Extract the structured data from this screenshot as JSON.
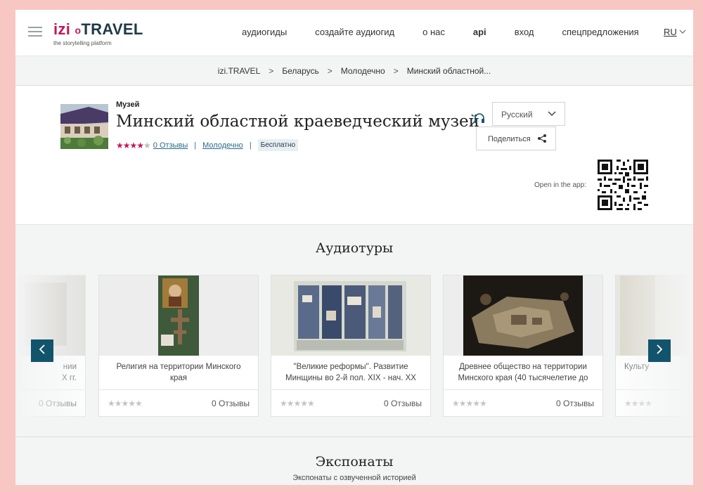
{
  "header": {
    "logo": {
      "izi": "izi",
      "dot": "o",
      "travel": "TRAVEL",
      "tagline": "the storytelling platform"
    },
    "nav": [
      "аудиогиды",
      "создайте аудиогид",
      "о нас",
      "api",
      "вход",
      "спецпредложения"
    ],
    "language": "RU"
  },
  "breadcrumb": [
    "izi.TRAVEL",
    "Беларусь",
    "Молодечно",
    "Минский областной..."
  ],
  "museum": {
    "category": "Музей",
    "title": "Минский областной краеведческий музей",
    "rating_stars": "★★★★",
    "rating_empty": "★",
    "rating_value": 4,
    "reviews": "0 Отзывы",
    "city": "Молодечно",
    "price": "Бесплатно",
    "language_select": "Русский",
    "share": "Поделиться",
    "open_in_app": "Open in the app:"
  },
  "audiotours": {
    "title": "Аудиотуры",
    "cards": [
      {
        "title": "Религия на территории Минского края",
        "stars": "★★★★★",
        "reviews": "0 Отзывы"
      },
      {
        "title": "\"Великие реформы\". Развитие Минщины во 2-й пол. XIX - нач. XX",
        "stars": "★★★★★",
        "reviews": "0 Отзывы"
      },
      {
        "title": "Древнее общество на территории Минского края (40 тысячелетие до",
        "stars": "★★★★★",
        "reviews": "0 Отзывы"
      }
    ],
    "left_partial": {
      "title_line1": "нии",
      "title_line2": "X гг.",
      "reviews": "0 Отзывы"
    },
    "right_partial": {
      "title": "Культу",
      "stars": "★★★★"
    }
  },
  "exhibits": {
    "title": "Экспонаты",
    "subtitle": "Экспонаты с озвученной историей"
  },
  "colors": {
    "accent": "#c2185b",
    "nav_button": "#12546b",
    "link": "#2a6c8a"
  }
}
